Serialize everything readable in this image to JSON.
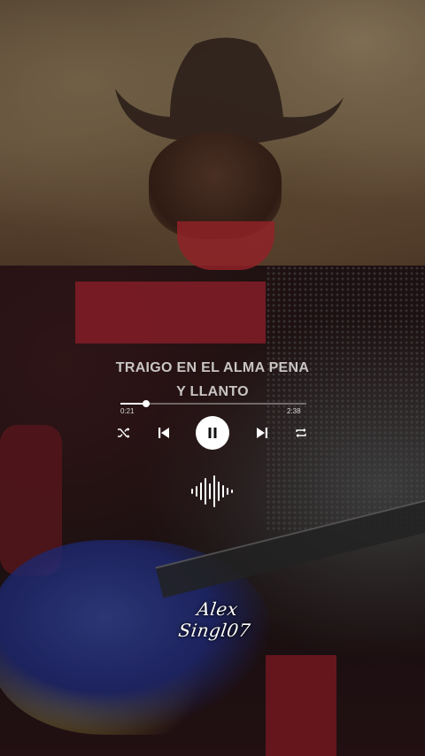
{
  "song": {
    "title_line1": "TRAIGO EN EL ALMA PENA",
    "title_line2": "Y LLANTO"
  },
  "progress": {
    "current_time": "0:21",
    "total_time": "2:38",
    "fraction": 0.14
  },
  "controls": {
    "shuffle_icon": "shuffle-icon",
    "previous_icon": "skip-previous-icon",
    "play_state_icon": "pause-icon",
    "next_icon": "skip-next-icon",
    "repeat_icon": "repeat-icon"
  },
  "visualizer_icon": "audio-waveform-icon",
  "watermark": "Alex Singl07",
  "colors": {
    "text": "#c9c5c5",
    "button_bg": "#ffffff",
    "accent_red": "#9a2430"
  }
}
